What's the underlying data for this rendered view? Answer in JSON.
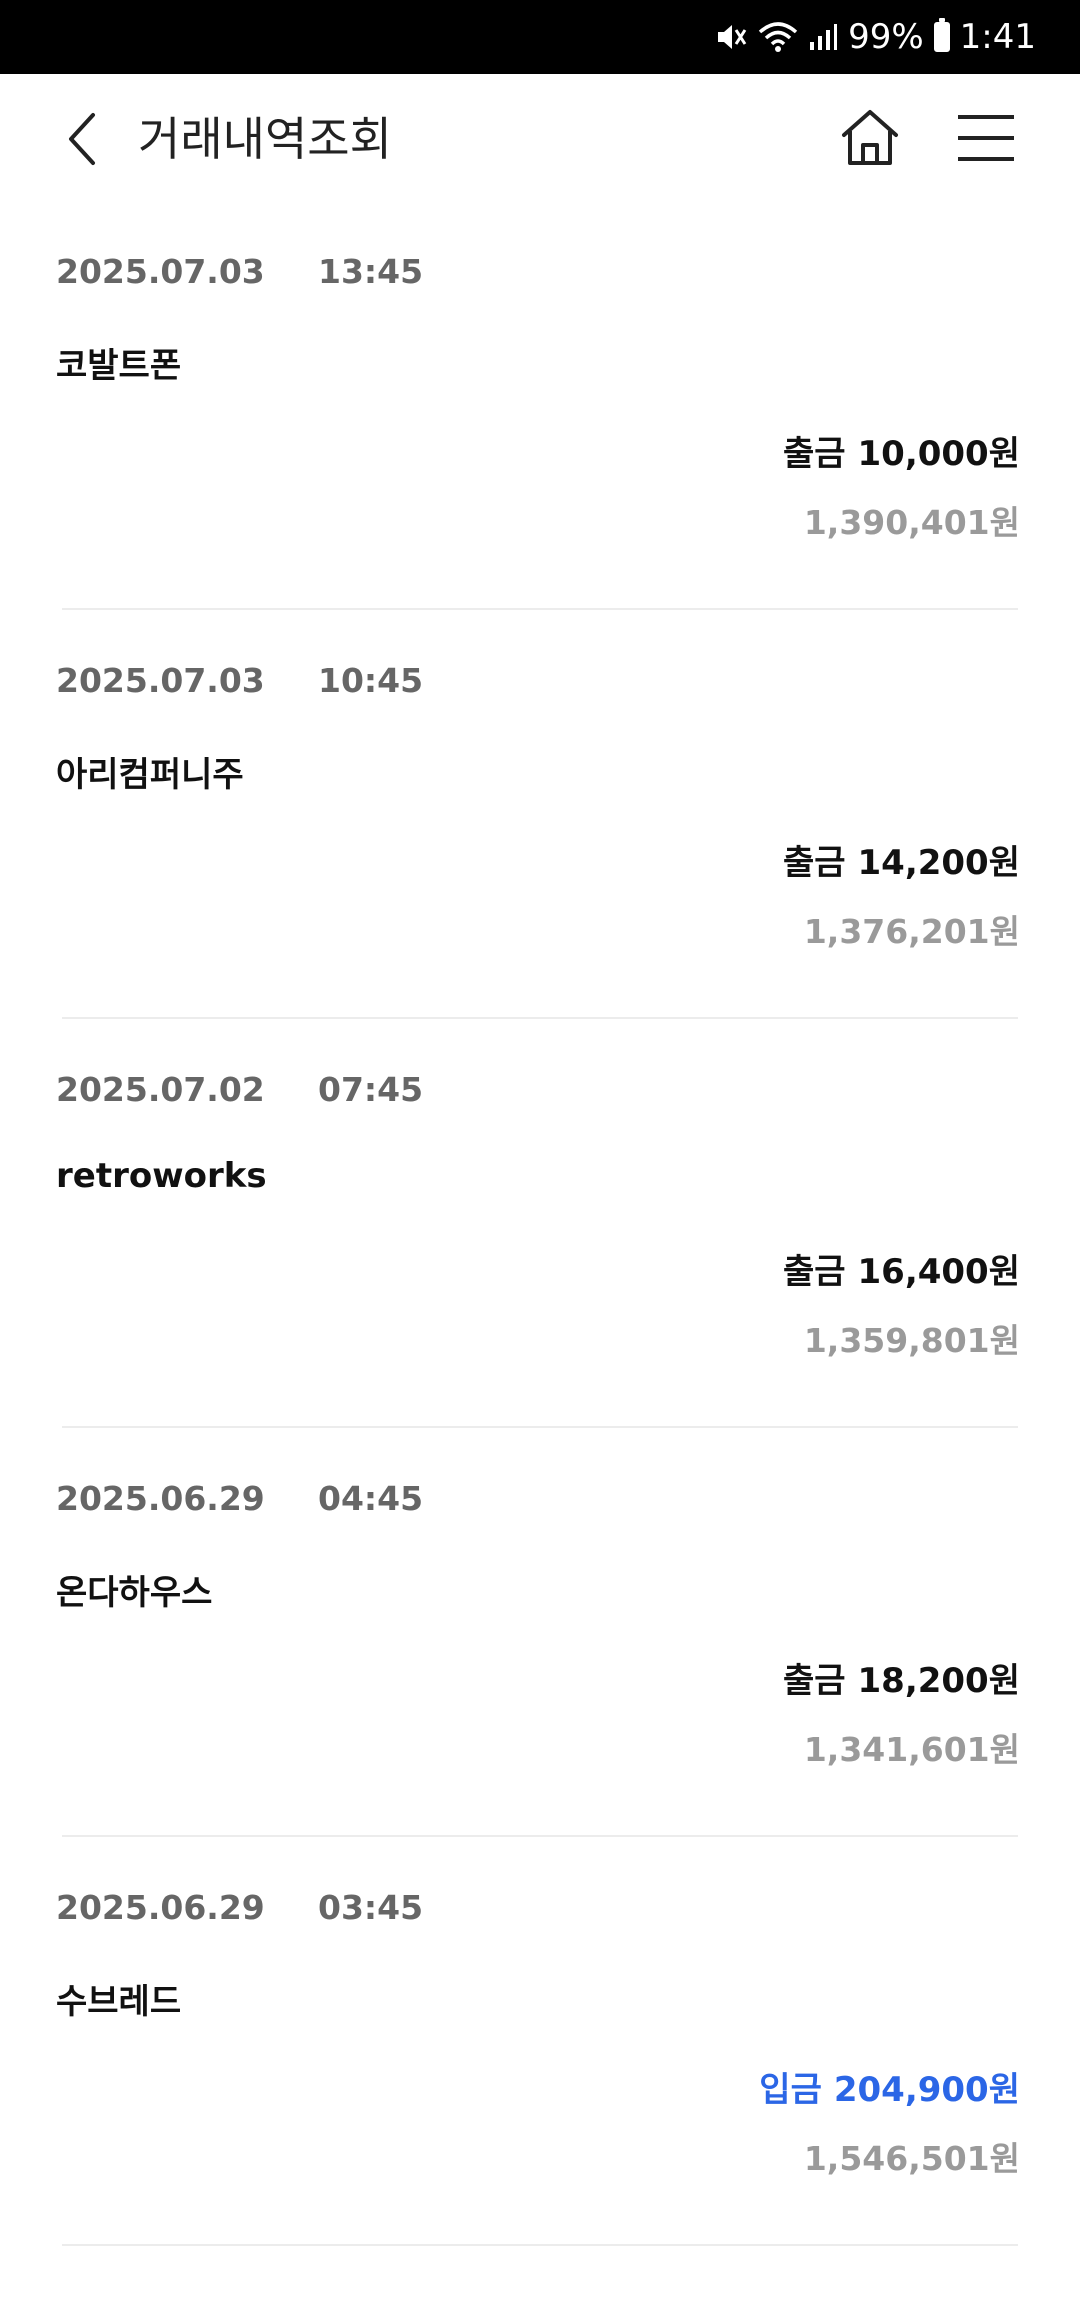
{
  "status_bar": {
    "battery": "99%",
    "time": "1:41",
    "icons": [
      "mute-icon",
      "wifi-icon",
      "signal-icon",
      "battery-icon"
    ]
  },
  "header": {
    "title": "거래내역조회",
    "icons": [
      "back-chevron-icon",
      "home-icon",
      "menu-icon"
    ]
  },
  "colors": {
    "withdraw": "#111111",
    "deposit": "#2b66e6",
    "balance": "#9a9a9a",
    "meta": "#666666"
  },
  "transactions": [
    {
      "date": "2025.07.03",
      "time": "13:45",
      "merchant": "코발트폰",
      "type": "출금",
      "amount": "10,000원",
      "balance": "1,390,401원"
    },
    {
      "date": "2025.07.03",
      "time": "10:45",
      "merchant": "아리컴퍼니주",
      "type": "출금",
      "amount": "14,200원",
      "balance": "1,376,201원"
    },
    {
      "date": "2025.07.02",
      "time": "07:45",
      "merchant": "retroworks",
      "type": "출금",
      "amount": "16,400원",
      "balance": "1,359,801원"
    },
    {
      "date": "2025.06.29",
      "time": "04:45",
      "merchant": "온다하우스",
      "type": "출금",
      "amount": "18,200원",
      "balance": "1,341,601원"
    },
    {
      "date": "2025.06.29",
      "time": "03:45",
      "merchant": "수브레드",
      "type": "입금",
      "amount": "204,900원",
      "balance": "1,546,501원"
    }
  ]
}
